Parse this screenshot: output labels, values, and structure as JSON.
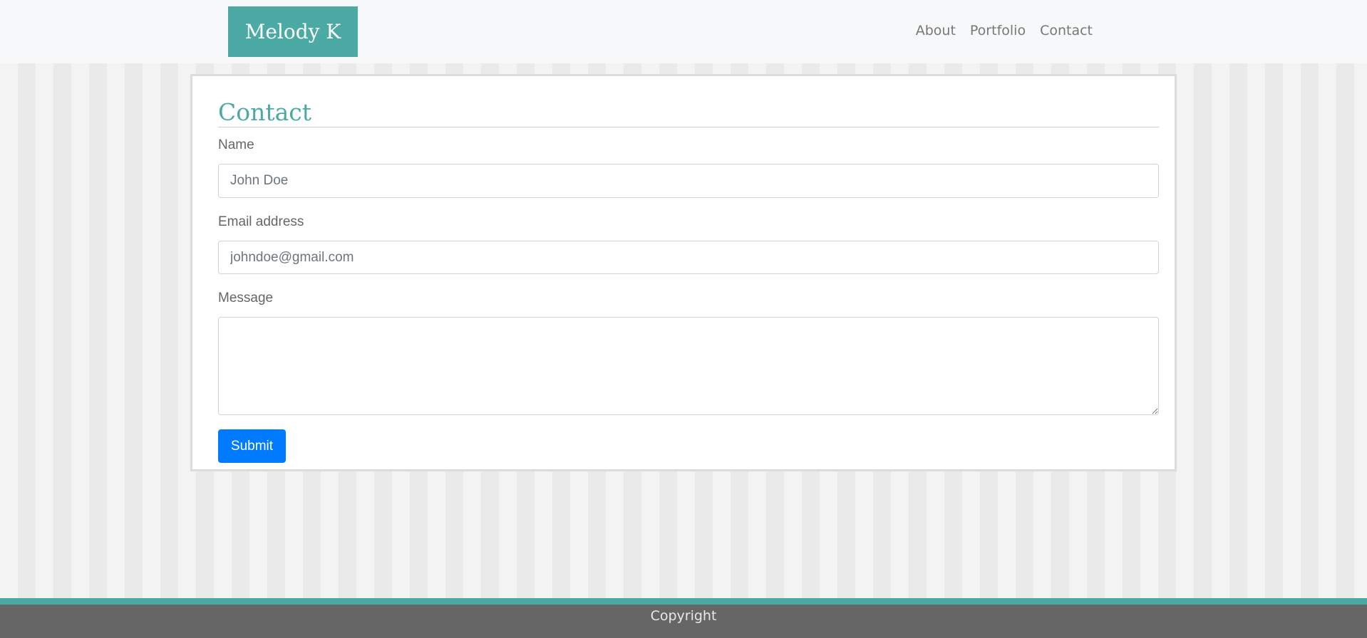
{
  "navbar": {
    "brand": "Melody K",
    "links": [
      {
        "label": "About"
      },
      {
        "label": "Portfolio"
      },
      {
        "label": "Contact"
      }
    ]
  },
  "contact": {
    "title": "Contact",
    "name_label": "Name",
    "name_placeholder": "John Doe",
    "email_label": "Email address",
    "email_placeholder": "johndoe@gmail.com",
    "message_label": "Message",
    "message_value": "",
    "submit_label": "Submit"
  },
  "footer": {
    "text": "Copyright"
  },
  "colors": {
    "accent": "#4caaa5",
    "button": "#007bff",
    "footer": "#666666",
    "navbar": "#f7f8f9"
  }
}
